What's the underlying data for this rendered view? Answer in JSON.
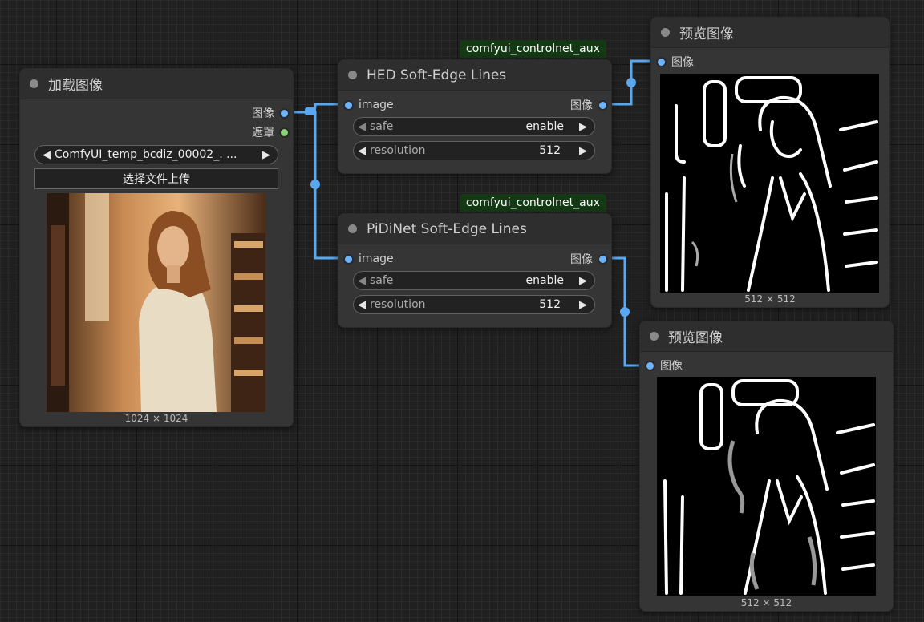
{
  "load_node": {
    "title": "加载图像",
    "outputs": [
      "图像",
      "遮罩"
    ],
    "file_value": "ComfyUI_temp_bcdiz_00002_. ...",
    "upload_label": "选择文件上传",
    "dims": "1024 × 1024",
    "image_desc": "woman-bookstore-photo"
  },
  "hed_node": {
    "badge": "comfyui_controlnet_aux",
    "title": "HED Soft-Edge Lines",
    "input": "image",
    "output": "图像",
    "widgets": [
      {
        "name": "safe",
        "value": "enable"
      },
      {
        "name": "resolution",
        "value": "512"
      }
    ]
  },
  "pidi_node": {
    "badge": "comfyui_controlnet_aux",
    "title": "PiDiNet Soft-Edge Lines",
    "input": "image",
    "output": "图像",
    "widgets": [
      {
        "name": "safe",
        "value": "enable"
      },
      {
        "name": "resolution",
        "value": "512"
      }
    ]
  },
  "preview1": {
    "title": "预览图像",
    "input": "图像",
    "dims": "512 × 512"
  },
  "preview2": {
    "title": "预览图像",
    "input": "图像",
    "dims": "512 × 512"
  },
  "colors": {
    "link": "#5aa8f0",
    "node_bg": "#353535",
    "badge_bg": "#133a13",
    "canvas": "#202020"
  }
}
